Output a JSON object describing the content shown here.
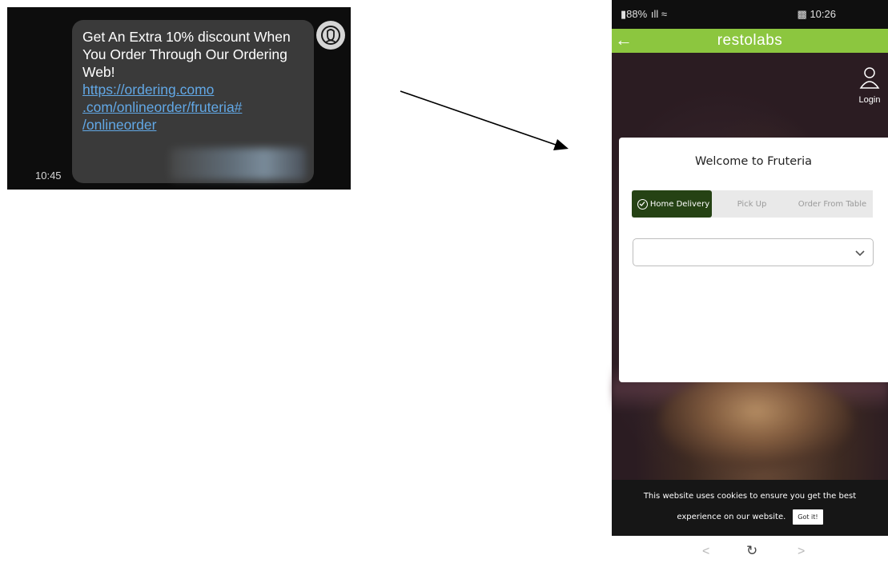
{
  "sms": {
    "message": "Get An Extra 10% discount When You Order Through Our Ordering Web!",
    "link_lines": [
      ".com/onlineorder/fruteria#",
      "/onlineorder"
    ],
    "link_first": "https://ordering.como",
    "time": "10:45"
  },
  "phone": {
    "status": {
      "left": "88%",
      "time": "10:26"
    },
    "appbar": {
      "title": "restolabs"
    },
    "login_label": "Login",
    "modal": {
      "title": "Welcome to Fruteria",
      "tabs": [
        {
          "label": "Home Delivery",
          "active": true
        },
        {
          "label": "Pick Up",
          "active": false
        },
        {
          "label": "Order From Table",
          "active": false
        }
      ],
      "select_value": ""
    },
    "cookie": {
      "line1": "This website uses cookies to ensure you get the best",
      "line2": "experience on our website.",
      "button": "Got it!"
    }
  },
  "colors": {
    "appbar": "#8cc63f",
    "active_tab": "#254214",
    "link": "#62a8e6"
  }
}
